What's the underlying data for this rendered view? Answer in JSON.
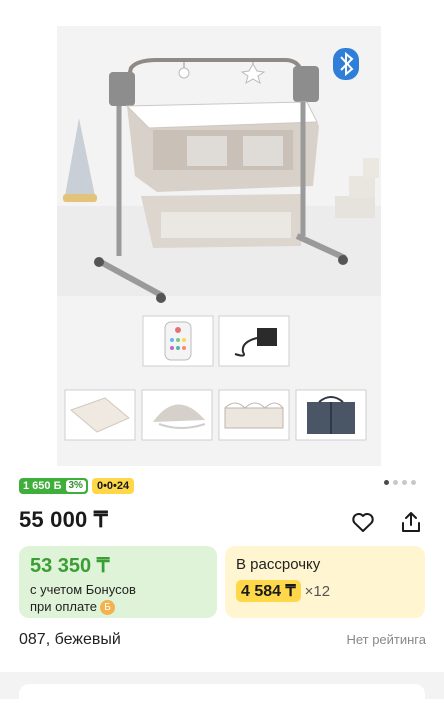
{
  "gallery": {
    "photo_alt": "bassinet",
    "badge_icon": "bluetooth-icon",
    "accessories": [
      "remote-control",
      "power-adapter",
      "mattress",
      "canopy",
      "side-panel",
      "carry-bag"
    ],
    "dots": 4,
    "active_dot": 0
  },
  "badges": {
    "bonus_amount": "1 650 Б",
    "bonus_percent": "3%",
    "installment": "0•0•24"
  },
  "price": "55 000 ₸",
  "bonus_card": {
    "price": "53 350 ₸",
    "note_line1": "с учетом Бонусов",
    "note_line2": "при оплате",
    "coin_icon": "Б"
  },
  "installment_card": {
    "title": "В рассрочку",
    "amount": "4 584 ₸",
    "multiplier": "×12"
  },
  "variant": "087, бежевый",
  "rating": "Нет рейтинга",
  "colors": {
    "green": "#3fae3b",
    "yellow": "#ffd84a",
    "green_card": "#dff3d8",
    "yellow_card": "#fff6d1"
  }
}
